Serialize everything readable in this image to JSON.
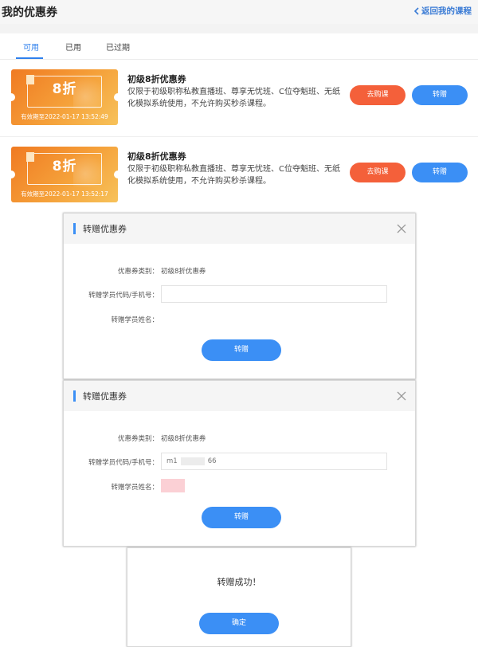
{
  "header": {
    "title": "我的优惠券",
    "back_label": "返回我的课程"
  },
  "tabs": [
    {
      "label": "可用",
      "active": true
    },
    {
      "label": "已用",
      "active": false
    },
    {
      "label": "已过期",
      "active": false
    }
  ],
  "coupons": [
    {
      "discount": "8折",
      "validity": "有效期至2022-01-17 13:52:49",
      "title": "初级8折优惠券",
      "desc": "仅限于初级职称私教直播班、尊享无忧班、C位夺魁班、无纸化模拟系统使用，不允许购买秒杀课程。",
      "buy_label": "去购课",
      "gift_label": "转赠"
    },
    {
      "discount": "8折",
      "validity": "有效期至2022-01-17 13:52:17",
      "title": "初级8折优惠券",
      "desc": "仅限于初级职称私教直播班、尊享无忧班、C位夺魁班、无纸化模拟系统使用，不允许购买秒杀课程。",
      "buy_label": "去购课",
      "gift_label": "转赠"
    }
  ],
  "dialog1": {
    "title": "转赠优惠券",
    "type_label": "优惠券类别：",
    "type_value": "初级8折优惠券",
    "code_label": "转赠学员代码/手机号：",
    "code_value": "",
    "name_label": "转赠学员姓名：",
    "submit_label": "转赠"
  },
  "dialog2": {
    "title": "转赠优惠券",
    "type_label": "优惠券类别：",
    "type_value": "初级8折优惠券",
    "code_label": "转赠学员代码/手机号：",
    "code_prefix": "m1",
    "code_suffix": "66",
    "name_label": "转赠学员姓名：",
    "submit_label": "转赠"
  },
  "success": {
    "message": "转赠成功！",
    "confirm_label": "确定"
  },
  "colors": {
    "primary": "#3b8ff5",
    "buy": "#f4603a",
    "ticket": "#f5a13a"
  }
}
